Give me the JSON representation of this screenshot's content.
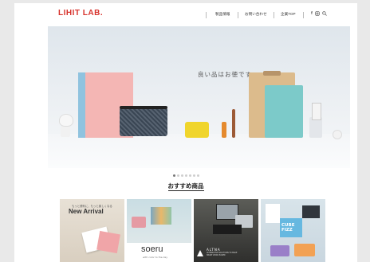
{
  "header": {
    "logo": "LIHIT LAB.",
    "nav": [
      "製品情報",
      "お問い合わせ",
      "企業TOP"
    ],
    "icons": [
      "facebook-icon",
      "instagram-icon",
      "search-icon"
    ]
  },
  "hero": {
    "tagline": "良い品はお徳です",
    "slides_total": 7,
    "active_slide": 1
  },
  "recommended": {
    "title": "おすすめ商品",
    "cards": [
      {
        "small": "もっと便利に、もっと楽しくなる",
        "label": "New Arrival"
      },
      {
        "label": "soeru",
        "sub": "with color to the day"
      },
      {
        "label": "ALTNA",
        "sub": "ALTERNATIVE SOLUTIONS TO MAKE SMART WORK EASIER"
      },
      {
        "label": "CUBE FIZZ"
      }
    ]
  },
  "colors": {
    "brand": "#d7322c"
  }
}
